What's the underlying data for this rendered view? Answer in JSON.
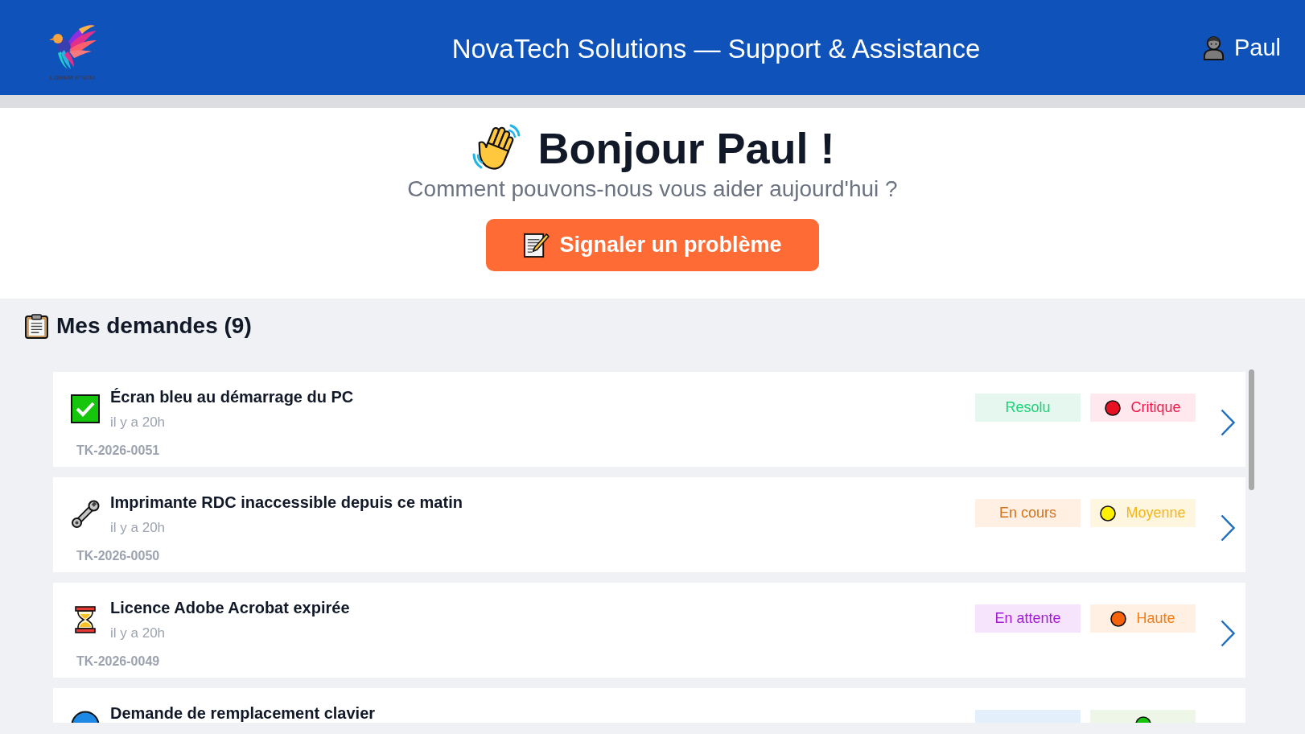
{
  "header": {
    "logo": {
      "text": "**LOREM** IPSUM"
    },
    "title": "NovaTech Solutions — Support & Assistance",
    "user": {
      "name": "Paul"
    }
  },
  "greeting": {
    "title": "Bonjour Paul !",
    "subtitle": "Comment pouvons-nous vous aider aujourd'hui ?",
    "button": {
      "label": "Signaler un problème"
    }
  },
  "requests": {
    "title": "Mes demandes (9)",
    "items": [
      {
        "kind": "resolved",
        "title": "Écran bleu au démarrage du PC",
        "time": "il y a 20h",
        "reference": "TK-2026-0051",
        "status": {
          "label": "Resolu",
          "color": "#e5f7ee"
        },
        "priority": {
          "label": "Critique",
          "color": "#ffe9ee",
          "dot": {
            "color": "#e81123"
          }
        }
      },
      {
        "kind": "progress",
        "title": "Imprimante RDC inaccessible depuis ce matin",
        "time": "il y a 20h",
        "reference": "TK-2026-0050",
        "status": {
          "label": "En cours",
          "color": "#fff0e3"
        },
        "priority": {
          "label": "Moyenne",
          "color": "#fff6e0",
          "dot": {
            "color": "#fff100"
          }
        }
      },
      {
        "kind": "waiting",
        "title": "Licence Adobe Acrobat expirée",
        "time": "il y a 20h",
        "reference": "TK-2026-0049",
        "status": {
          "label": "En attente",
          "color": "#f5e4fb"
        },
        "priority": {
          "label": "Haute",
          "color": "#fff0e3",
          "dot": {
            "color": "#f7630c"
          }
        }
      },
      {
        "kind": "new",
        "title": "Demande de remplacement clavier",
        "status": {
          "color": "#e3effb"
        },
        "priority": {
          "color": "#eef6e8",
          "dot": {
            "color": "#16c60c"
          }
        }
      }
    ]
  }
}
